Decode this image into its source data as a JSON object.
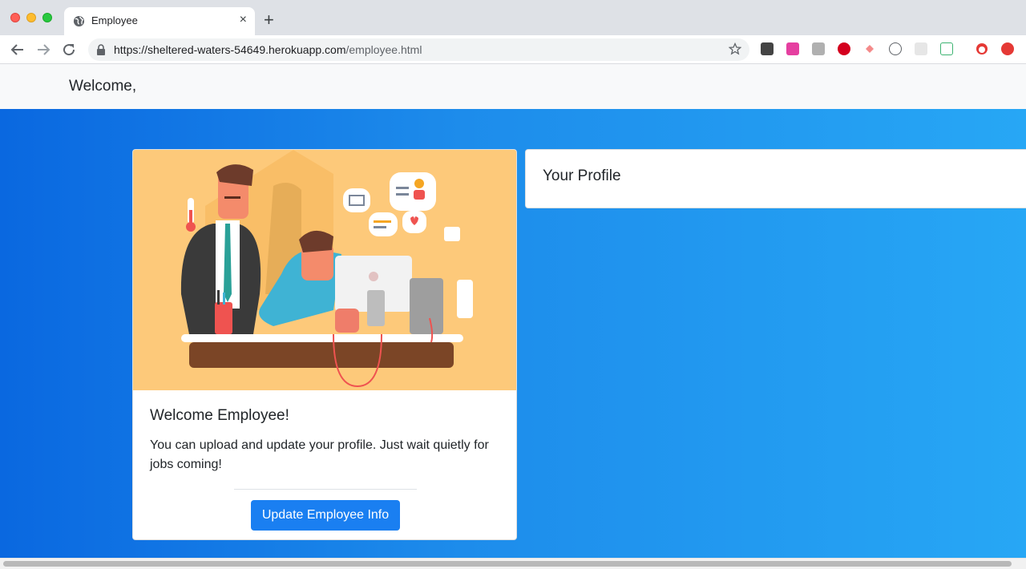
{
  "browser": {
    "tab_title": "Employee",
    "tab_close": "×",
    "new_tab": "+",
    "url_domain": "https://sheltered-waters-54649.herokuapp.com",
    "url_path": "/employee.html",
    "extension_icons": [
      "bookmark-ext-icon",
      "grammarly-icon",
      "ext-grey-icon",
      "adblock-plus-icon",
      "ext-arrow-icon",
      "ext-dots-icon",
      "ext-grid-icon",
      "ext-chart-icon",
      "profile-avatar-icon",
      "ext-red-icon"
    ]
  },
  "header": {
    "welcome": "Welcome,"
  },
  "card": {
    "title": "Welcome Employee!",
    "text": "You can upload and update your profile. Just wait quietly for jobs coming!",
    "button": "Update Employee Info"
  },
  "profile": {
    "title": "Your Profile"
  },
  "colors": {
    "accent": "#1a7ff1",
    "hero_start": "#0a68e0",
    "hero_end": "#27a7f5",
    "illustration_bg": "#fdc97a"
  }
}
